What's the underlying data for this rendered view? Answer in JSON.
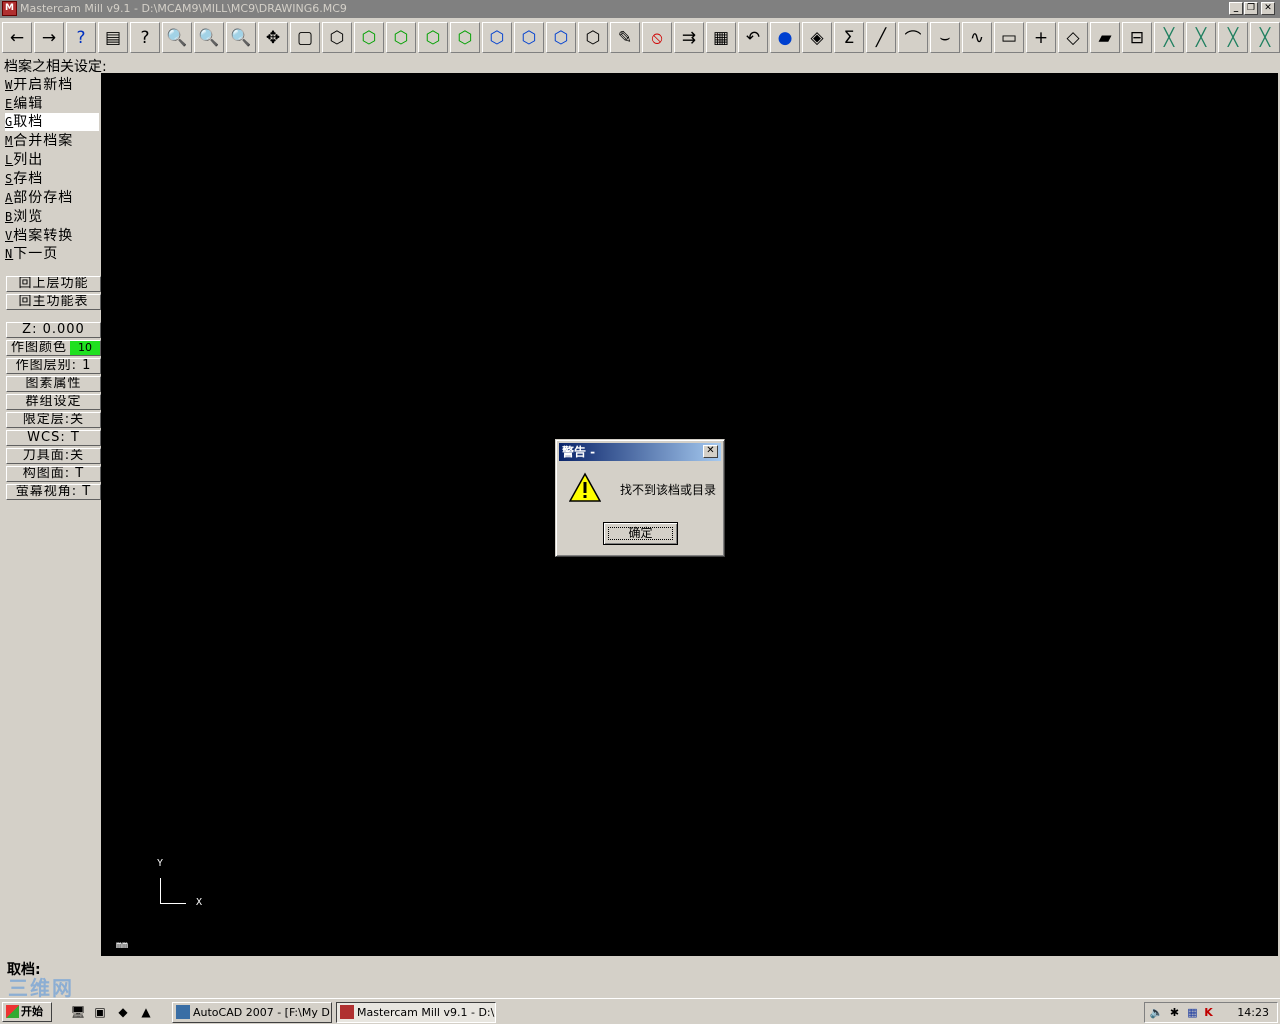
{
  "window": {
    "title": "Mastercam Mill v9.1 - D:\\MCAM9\\MILL\\MC9\\DRAWING6.MC9",
    "app_icon": "M",
    "buttons": [
      "minimize",
      "restore",
      "close"
    ]
  },
  "toolbar": {
    "buttons": [
      {
        "name": "back-icon",
        "glyph": "←"
      },
      {
        "name": "forward-icon",
        "glyph": "→"
      },
      {
        "name": "help-icon",
        "glyph": "?"
      },
      {
        "name": "calculator-icon",
        "glyph": "▤"
      },
      {
        "name": "analyze-icon",
        "glyph": "?"
      },
      {
        "name": "zoom-window-icon",
        "glyph": "🔍"
      },
      {
        "name": "zoom-fit-icon",
        "glyph": "🔍"
      },
      {
        "name": "unzoom-icon",
        "glyph": "🔍"
      },
      {
        "name": "pan-icon",
        "glyph": "✥"
      },
      {
        "name": "select-icon",
        "glyph": "▢"
      },
      {
        "name": "cube-iso-icon",
        "glyph": "⬡"
      },
      {
        "name": "green-cube-1-icon",
        "glyph": "⬡"
      },
      {
        "name": "green-cube-2-icon",
        "glyph": "⬡"
      },
      {
        "name": "green-cube-3-icon",
        "glyph": "⬡"
      },
      {
        "name": "green-cube-4-icon",
        "glyph": "⬡"
      },
      {
        "name": "blue-cube-1-icon",
        "glyph": "⬡"
      },
      {
        "name": "blue-cube-2-icon",
        "glyph": "⬡"
      },
      {
        "name": "blue-cube-3-icon",
        "glyph": "⬡"
      },
      {
        "name": "wire-cube-icon",
        "glyph": "⬡"
      },
      {
        "name": "pencil-icon",
        "glyph": "✎"
      },
      {
        "name": "no-delete-icon",
        "glyph": "⦸"
      },
      {
        "name": "transform-icon",
        "glyph": "⇉"
      },
      {
        "name": "colors-icon",
        "glyph": "▦"
      },
      {
        "name": "undo-icon",
        "glyph": "↶"
      },
      {
        "name": "sphere-icon",
        "glyph": "●"
      },
      {
        "name": "surfaces-icon",
        "glyph": "◈"
      },
      {
        "name": "sum-icon",
        "glyph": "Σ"
      },
      {
        "name": "line-icon",
        "glyph": "╱"
      },
      {
        "name": "arc-icon",
        "glyph": "⌒"
      },
      {
        "name": "fillet-icon",
        "glyph": "⌣"
      },
      {
        "name": "spline-icon",
        "glyph": "∿"
      },
      {
        "name": "rectangle-icon",
        "glyph": "▭"
      },
      {
        "name": "point-icon",
        "glyph": "+"
      },
      {
        "name": "plane-icon",
        "glyph": "◇"
      },
      {
        "name": "solid-icon",
        "glyph": "▰"
      },
      {
        "name": "tree-icon",
        "glyph": "⊟"
      },
      {
        "name": "trim-1-icon",
        "glyph": "╳"
      },
      {
        "name": "trim-2-icon",
        "glyph": "╳"
      },
      {
        "name": "trim-3-icon",
        "glyph": "╳"
      },
      {
        "name": "trim-4-icon",
        "glyph": "╳"
      }
    ]
  },
  "prompt_line": "档案之相关设定:",
  "menu": {
    "items": [
      {
        "key": "W",
        "label": "开启新档"
      },
      {
        "key": "E",
        "label": "编辑"
      },
      {
        "key": "G",
        "label": "取档"
      },
      {
        "key": "M",
        "label": "合并档案"
      },
      {
        "key": "L",
        "label": "列出"
      },
      {
        "key": "S",
        "label": "存档"
      },
      {
        "key": "A",
        "label": "部份存档"
      },
      {
        "key": "B",
        "label": "浏览"
      },
      {
        "key": "V",
        "label": "档案转换"
      },
      {
        "key": "N",
        "label": "下一页"
      }
    ],
    "selected_index": 2,
    "nav_buttons": [
      "回上层功能",
      "回主功能表"
    ],
    "settings": [
      "Z:  0.000",
      "作图颜色",
      "作图层别:  1",
      "图素属性",
      "群组设定",
      "限定层:关",
      "WCS:  T",
      "刀具面:关",
      "构图面:  T",
      "萤幕视角:  T"
    ],
    "color_value": "10",
    "color_swatch": "#20e020"
  },
  "viewport": {
    "axis_y": "Y",
    "axis_x": "X",
    "units": "mm"
  },
  "bottom_prompt": "取档:",
  "watermark": "三维网",
  "dialog": {
    "title": "警告 -",
    "message": "找不到该档或目录",
    "ok_label": "确定",
    "icon": "warning-icon"
  },
  "taskbar": {
    "start_label": "开始",
    "tasks": [
      {
        "label": "AutoCAD 2007 - [F:\\My D...",
        "active": false
      },
      {
        "label": "Mastercam Mill v9.1 - D:\\...",
        "active": true
      }
    ],
    "clock": "14:23"
  }
}
